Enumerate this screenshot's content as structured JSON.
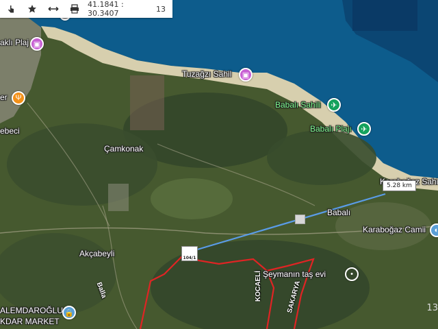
{
  "toolbar": {
    "buttons": [
      {
        "icon": "tap-icon"
      },
      {
        "icon": "star-icon"
      },
      {
        "icon": "measure-icon"
      },
      {
        "icon": "print-icon"
      }
    ],
    "coordinates": "41.1841 : 30.3407",
    "zoom": "13"
  },
  "labels": {
    "akli_plaj": "aklı Plaj",
    "tuzagzi_sahil": "Tuzağzı Sahil",
    "babali_sahili": "Babalı Sahili",
    "babali_plaji": "Babalı Plajı",
    "er": "er",
    "ebeci": "ebeci",
    "camkonak": "Çamkonak",
    "karabogaz_sahil": "Karaboğaz Sahi",
    "babali": "Babalı",
    "karabogaz_camii": "Karaboğaz Camii",
    "akcabeyli": "Akçabeyli",
    "seymanin_tas_evi": "Şeymanın taş evi",
    "alemdaroglu_line1": "ALEMDAROĞLU",
    "alemdaroglu_line2": "KDAR MARKET",
    "kocaeli": "KOCAELİ",
    "sakarya": "SAKARYA",
    "balla": "Balla"
  },
  "measurement": {
    "distance": "5.28 km",
    "parcel": "104/1"
  },
  "scale_corner": "13",
  "colors": {
    "sea": "#0d5c8c",
    "sea_deep": "#0b3f6b",
    "beach": "#d9cfb0",
    "land": "#4d6137",
    "forest": "#34472a",
    "measure_line": "#4a90e2",
    "boundary": "#e02828"
  }
}
